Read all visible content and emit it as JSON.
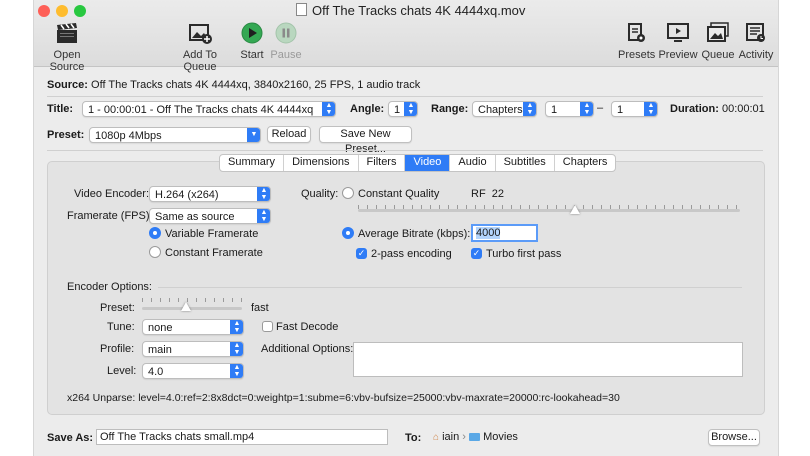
{
  "window": {
    "title": "Off The Tracks chats 4K 4444xq.mov"
  },
  "colors": {
    "accent": "#2f7cf6",
    "close": "#fe5f57",
    "minimize": "#febc2e",
    "zoom": "#28c840",
    "start_green": "#34a853"
  },
  "toolbar": {
    "open_source": "Open Source",
    "add_to_queue": "Add To Queue",
    "start": "Start",
    "pause": "Pause",
    "presets": "Presets",
    "preview": "Preview",
    "queue": "Queue",
    "activity": "Activity"
  },
  "source": {
    "label": "Source:",
    "value": "Off The Tracks chats 4K 4444xq, 3840x2160, 25 FPS, 1 audio track"
  },
  "title_row": {
    "title_label": "Title:",
    "title_value": "1 - 00:00:01 - Off The Tracks chats 4K 4444xq",
    "angle_label": "Angle:",
    "angle_value": "1",
    "range_label": "Range:",
    "range_type": "Chapters",
    "range_start": "1",
    "range_dash": "–",
    "range_end": "1",
    "duration_label": "Duration:",
    "duration_value": "00:00:01"
  },
  "preset_row": {
    "label": "Preset:",
    "value": "1080p 4Mbps",
    "reload": "Reload",
    "save_new": "Save New Preset..."
  },
  "tabs": [
    "Summary",
    "Dimensions",
    "Filters",
    "Video",
    "Audio",
    "Subtitles",
    "Chapters"
  ],
  "active_tab": "Video",
  "video": {
    "encoder_label": "Video Encoder:",
    "encoder_value": "H.264 (x264)",
    "framerate_label": "Framerate (FPS):",
    "framerate_value": "Same as source",
    "variable_framerate": "Variable Framerate",
    "constant_framerate": "Constant Framerate",
    "framerate_mode": "variable",
    "quality_label": "Quality:",
    "constant_quality": "Constant Quality",
    "rf_label": "RF",
    "rf_value": "22",
    "average_bitrate": "Average Bitrate (kbps):",
    "bitrate_value": "4000",
    "quality_mode": "average_bitrate",
    "two_pass": "2-pass encoding",
    "two_pass_checked": true,
    "turbo_first_pass": "Turbo first pass",
    "turbo_checked": true
  },
  "encoder_options": {
    "heading": "Encoder Options:",
    "preset_label": "Preset:",
    "preset_value": "fast",
    "tune_label": "Tune:",
    "tune_value": "none",
    "fast_decode": "Fast Decode",
    "fast_decode_checked": false,
    "profile_label": "Profile:",
    "profile_value": "main",
    "additional_label": "Additional Options:",
    "additional_value": "",
    "level_label": "Level:",
    "level_value": "4.0",
    "unparse": "x264 Unparse: level=4.0:ref=2:8x8dct=0:weightp=1:subme=6:vbv-bufsize=25000:vbv-maxrate=20000:rc-lookahead=30"
  },
  "save_row": {
    "label": "Save As:",
    "value": "Off The Tracks chats small.mp4",
    "to_label": "To:",
    "path_home": "iain",
    "path_sep": "›",
    "path_folder": "Movies",
    "browse": "Browse..."
  }
}
